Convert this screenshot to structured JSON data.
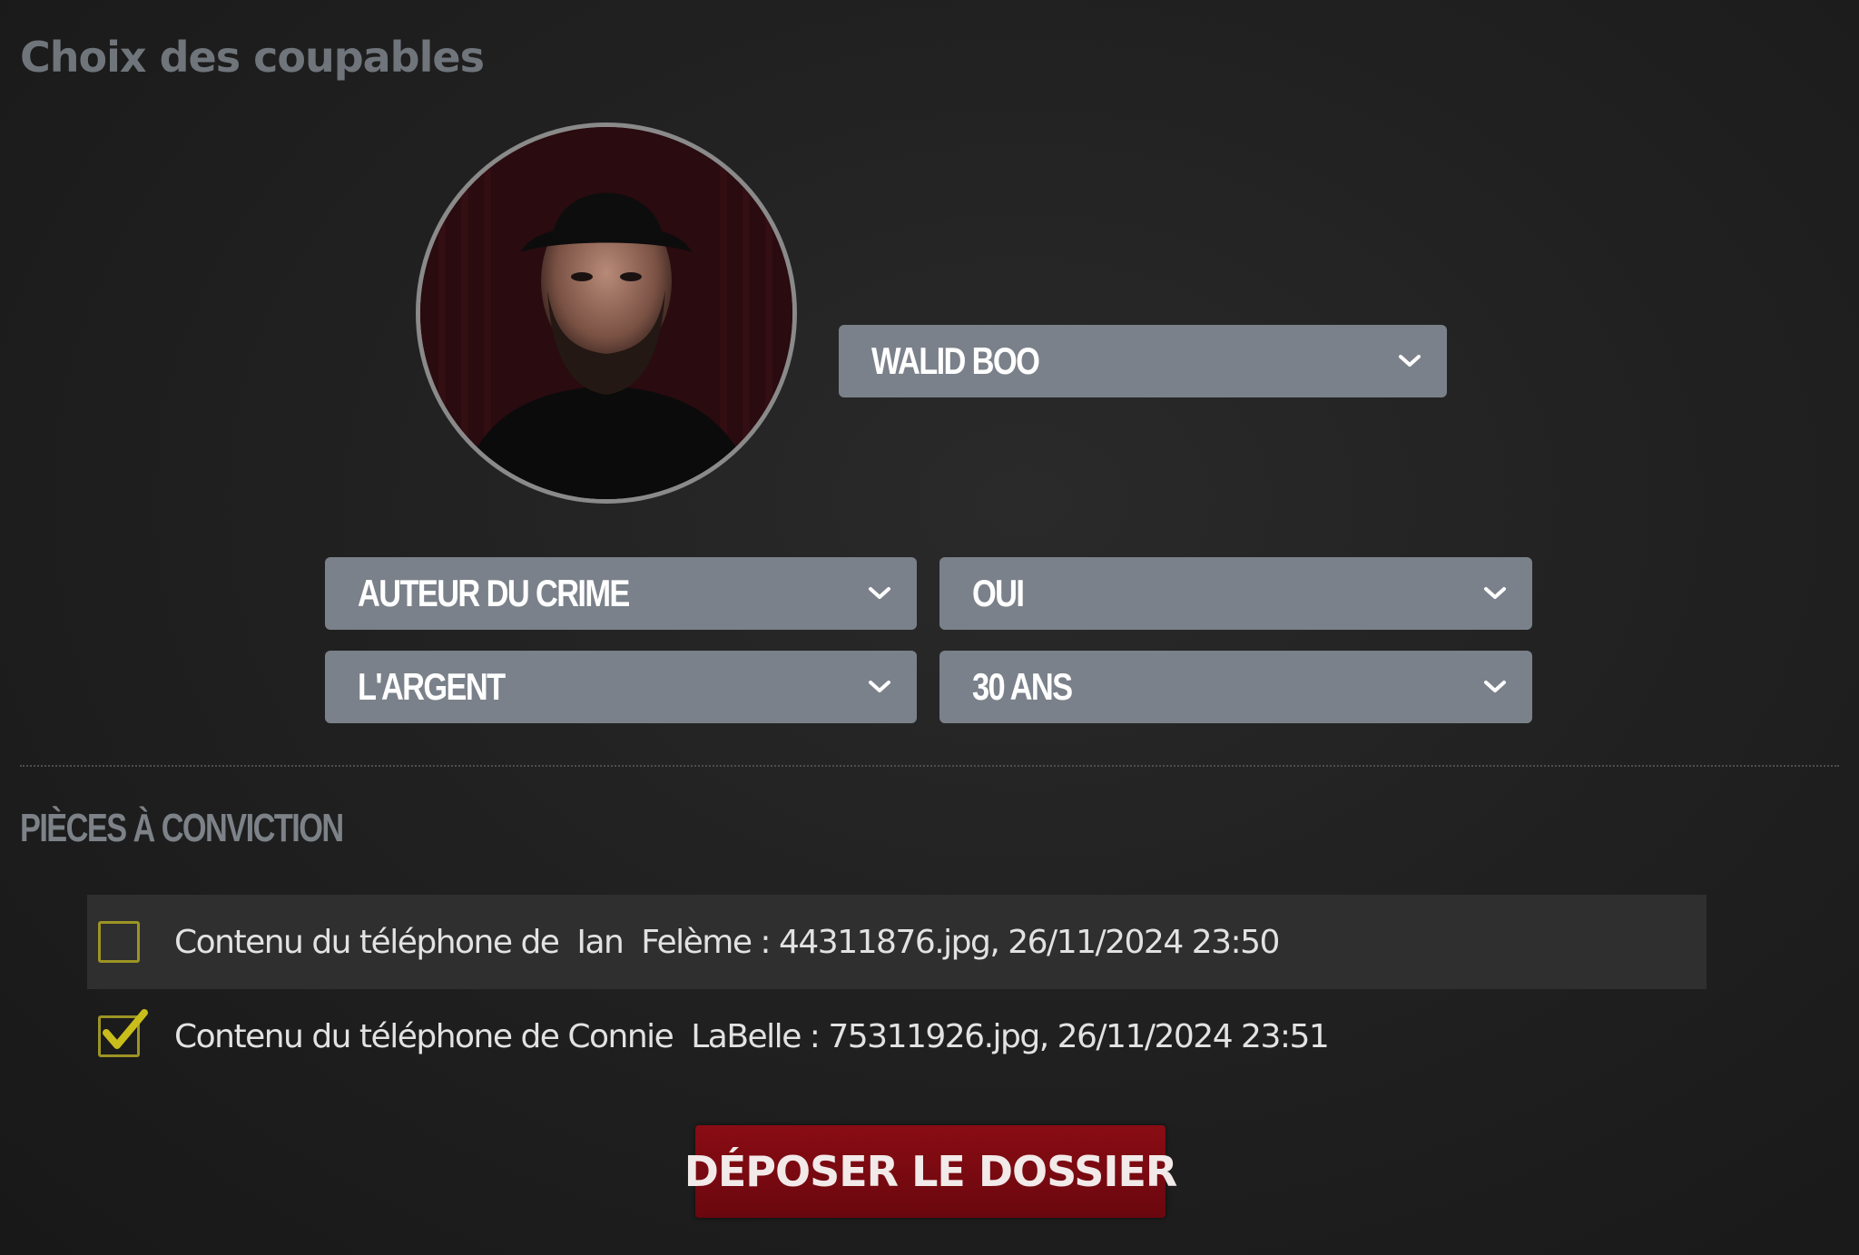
{
  "page": {
    "title": "Choix des coupables"
  },
  "suspect": {
    "portrait_alt": "portrait of suspect wearing a black hat"
  },
  "selects": {
    "suspect_name": "WALID BOO",
    "role": "AUTEUR DU CRIME",
    "confirmation": "OUI",
    "motive": "L'ARGENT",
    "sentence": "30 ANS"
  },
  "evidence": {
    "heading": "PIÈCES À CONVICTION",
    "items": [
      {
        "label": "Contenu du téléphone de  Ian  Felème : 44311876.jpg, 26/11/2024 23:50",
        "checked": false
      },
      {
        "label": "Contenu du téléphone de Connie  LaBelle : 75311926.jpg, 26/11/2024 23:51",
        "checked": true
      }
    ]
  },
  "actions": {
    "submit_label": "DÉPOSER LE DOSSIER"
  },
  "colors": {
    "select_bg": "#7a818a",
    "checkbox_accent": "#c9bd1c",
    "submit_bg": "#7e0a12",
    "title_gray": "#6f757b"
  },
  "icons": {
    "select_arrow": "chevron-down-icon",
    "check": "checkmark-icon"
  }
}
